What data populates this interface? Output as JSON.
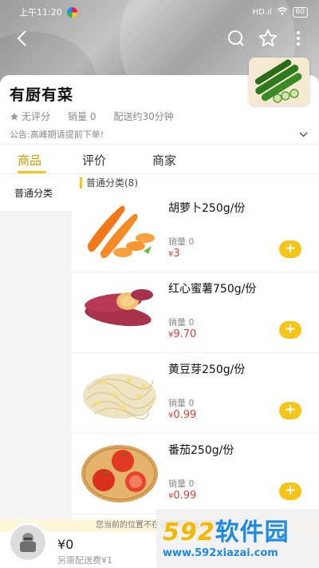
{
  "statusbar": {
    "time": "上午11:20",
    "signal": "HD.ıl",
    "wifi": "WiFi",
    "battery": "60"
  },
  "store": {
    "name": "有厨有菜",
    "rating": "无评分",
    "sales": "销量 0",
    "delivery": "配送约30分钟",
    "notice": "公告:高峰期请提前下单!"
  },
  "tabs": [
    {
      "label": "商品",
      "active": true
    },
    {
      "label": "评价",
      "active": false
    },
    {
      "label": "商家",
      "active": false
    }
  ],
  "sidebar": {
    "items": [
      {
        "label": "普通分类",
        "active": true
      }
    ]
  },
  "section": {
    "title": "普通分类(8)"
  },
  "products": [
    {
      "name": "胡萝卜250g/份",
      "sales": "销量 0",
      "currency": "¥",
      "price": "3",
      "image": "carrot"
    },
    {
      "name": "红心蜜薯750g/份",
      "sales": "销量 0",
      "currency": "¥",
      "price": "9.70",
      "image": "sweet-potato"
    },
    {
      "name": "黄豆芽250g/份",
      "sales": "销量 0",
      "currency": "¥",
      "price": "0.99",
      "image": "bean-sprouts"
    },
    {
      "name": "番茄250g/份",
      "sales": "销量 0",
      "currency": "¥",
      "price": "0.99",
      "image": "tomato"
    }
  ],
  "add_label": "+",
  "location_bar": {
    "text": "您当前的位置不在该商家配送范围内"
  },
  "cart": {
    "total": "¥0",
    "delivery_fee": "另需配送费¥1"
  },
  "watermark": {
    "logo_num": "592",
    "logo_cn": "软件园",
    "url": "www.592xiazai.com"
  },
  "colors": {
    "accent": "#f5c518",
    "price": "#d9403a",
    "tab_active": "#c89a00"
  }
}
